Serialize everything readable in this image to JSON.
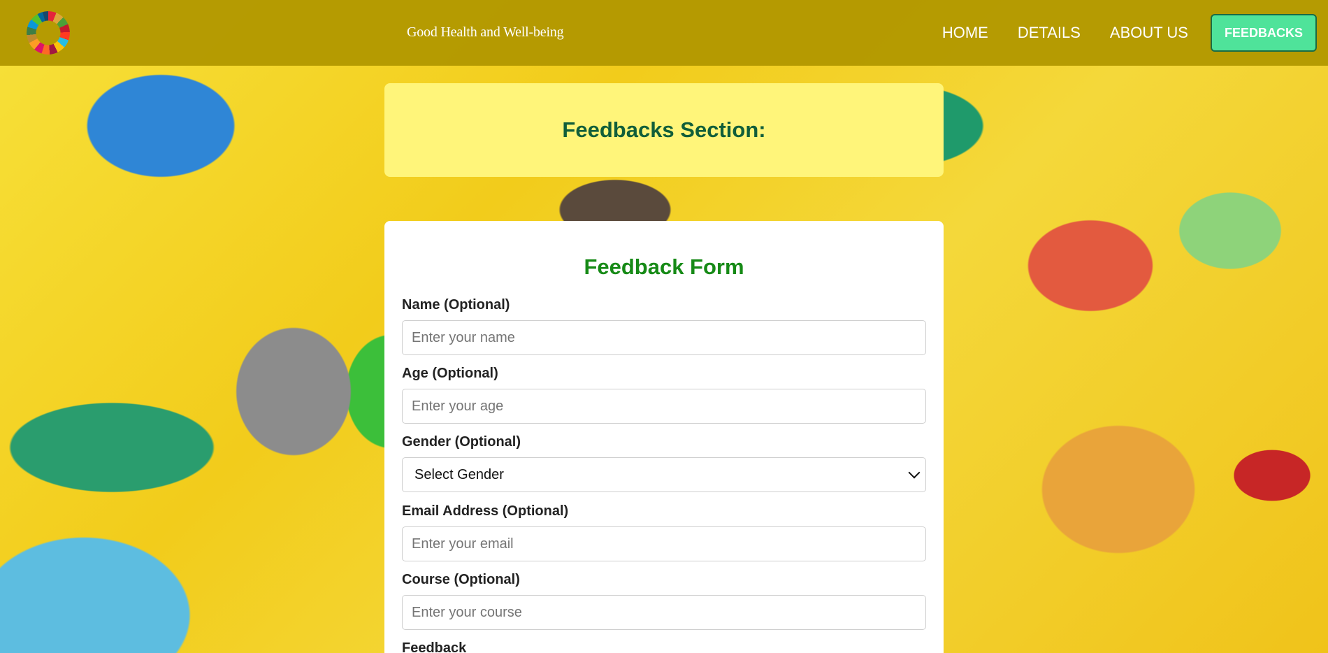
{
  "header": {
    "site_title": "Good Health and Well-being",
    "logo": "sdg-wheel-icon",
    "nav": [
      {
        "label": "HOME"
      },
      {
        "label": "DETAILS"
      },
      {
        "label": "ABOUT US"
      }
    ],
    "cta_label": "FEEDBACKS",
    "colors": {
      "bar": "#b29800",
      "cta": "#4fe39a"
    }
  },
  "section": {
    "title": "Feedbacks Section:",
    "background": "#fff57a"
  },
  "form": {
    "title": "Feedback Form",
    "fields": {
      "name": {
        "label": "Name (Optional)",
        "placeholder": "Enter your name"
      },
      "age": {
        "label": "Age (Optional)",
        "placeholder": "Enter your age"
      },
      "gender": {
        "label": "Gender (Optional)",
        "selected": "Select Gender"
      },
      "email": {
        "label": "Email Address (Optional)",
        "placeholder": "Enter your email"
      },
      "course": {
        "label": "Course (Optional)",
        "placeholder": "Enter your course"
      },
      "feedback": {
        "label": "Feedback"
      }
    }
  }
}
